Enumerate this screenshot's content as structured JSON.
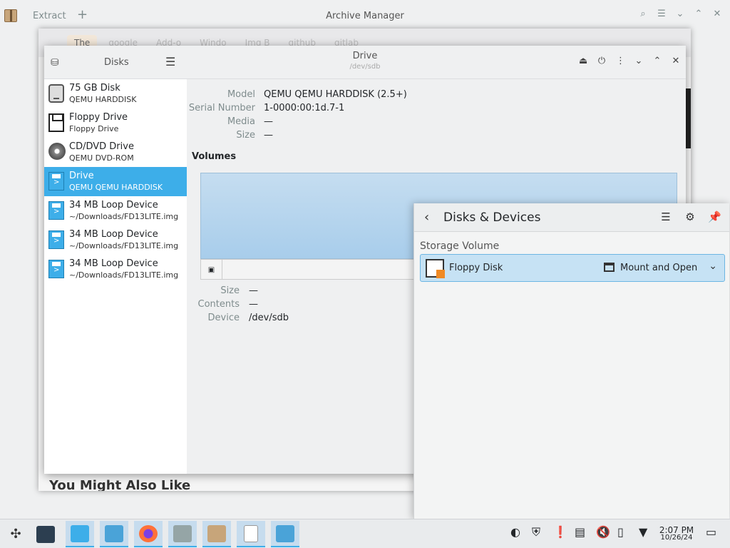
{
  "archive": {
    "extract_label": "Extract",
    "add_label": "+",
    "title": "Archive Manager"
  },
  "browser": {
    "tabs": [
      "The",
      "google",
      "Add-o",
      "Windo",
      "Img B",
      "github",
      "gitlab"
    ],
    "footer": "You Might Also Like"
  },
  "disks": {
    "sidebar_title": "Disks",
    "header_title": "Drive",
    "header_subtitle": "/dev/sdb",
    "drives": [
      {
        "name": "75 GB Disk",
        "sub": "QEMU HARDDISK",
        "icon": "harddisk-icon"
      },
      {
        "name": "Floppy Drive",
        "sub": "Floppy Drive",
        "icon": "floppy-icon"
      },
      {
        "name": "CD/DVD Drive",
        "sub": "QEMU DVD-ROM",
        "icon": "cdrom-icon"
      },
      {
        "name": "Drive",
        "sub": "QEMU QEMU HARDDISK",
        "icon": "usb-drive-icon",
        "selected": true
      },
      {
        "name": "34 MB Loop Device",
        "sub": "~/Downloads/FD13LITE.img",
        "icon": "usb-drive-icon"
      },
      {
        "name": "34 MB Loop Device",
        "sub": "~/Downloads/FD13LITE.img",
        "icon": "usb-drive-icon"
      },
      {
        "name": "34 MB Loop Device",
        "sub": "~/Downloads/FD13LITE.img",
        "icon": "usb-drive-icon"
      }
    ],
    "info": {
      "model_label": "Model",
      "model_value": "QEMU QEMU HARDDISK (2.5+)",
      "serial_label": "Serial Number",
      "serial_value": "1-0000:00:1d.7-1",
      "media_label": "Media",
      "media_value": "—",
      "size_label": "Size",
      "size_value": "—"
    },
    "volumes_title": "Volumes",
    "volume": {
      "size_label": "Size",
      "size_value": "—",
      "contents_label": "Contents",
      "contents_value": "—",
      "device_label": "Device",
      "device_value": "/dev/sdb"
    }
  },
  "popup": {
    "title": "Disks & Devices",
    "section": "Storage Volume",
    "item_name": "Floppy Disk",
    "item_action": "Mount and Open"
  },
  "taskbar": {
    "time": "2:07 PM",
    "date": "10/26/24"
  }
}
